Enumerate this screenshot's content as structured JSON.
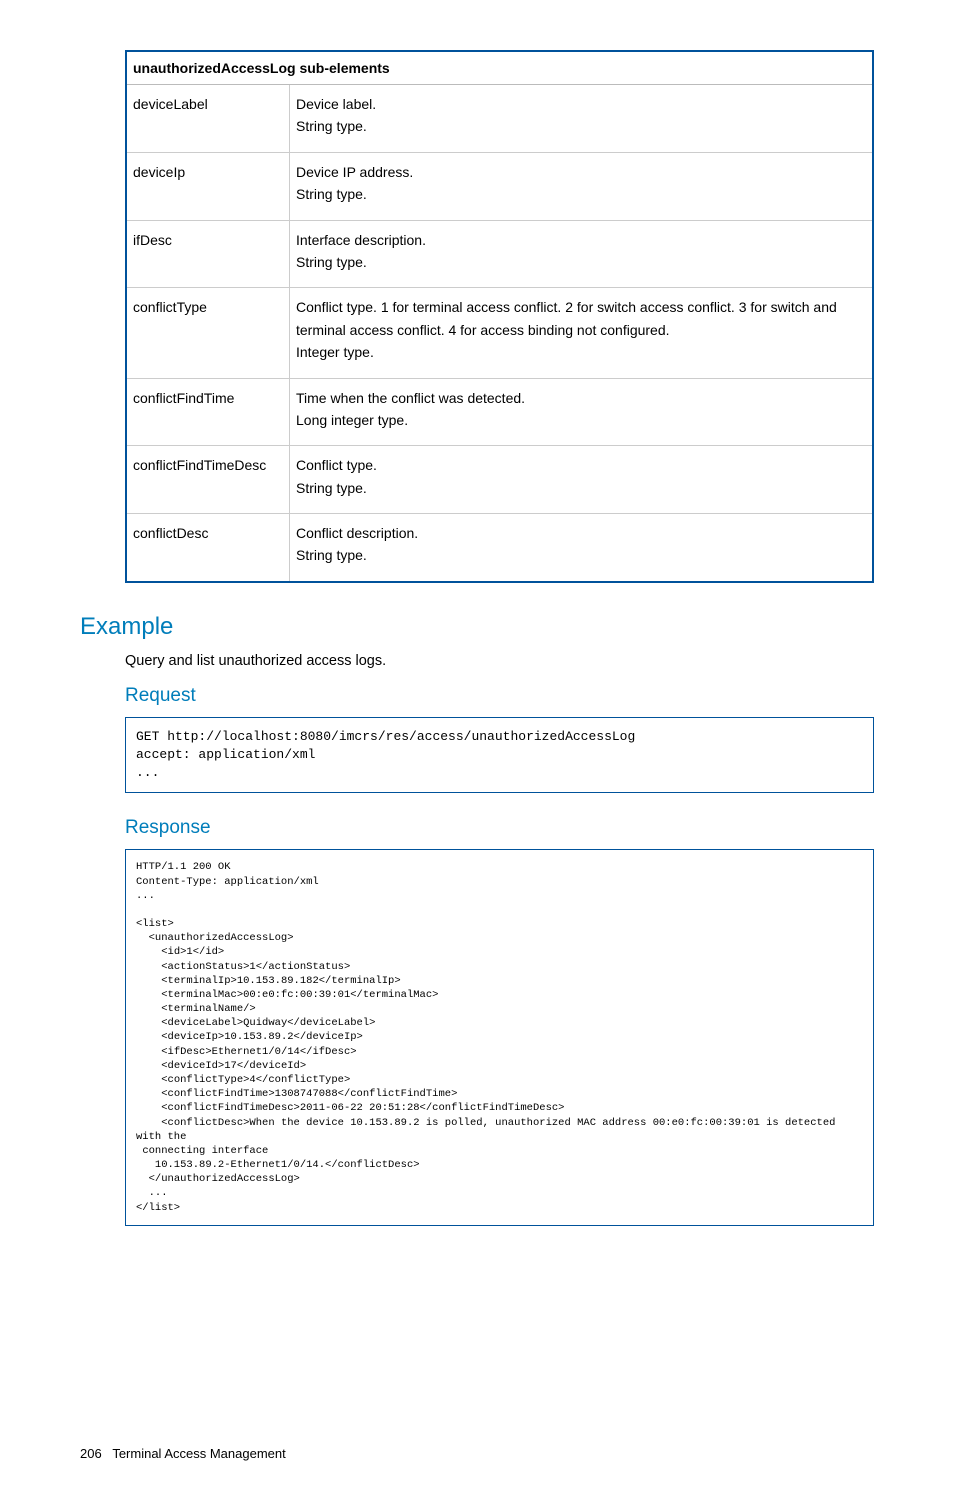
{
  "table": {
    "header": "unauthorizedAccessLog sub-elements",
    "rows": [
      {
        "name": "deviceLabel",
        "desc": "Device label.\nString type."
      },
      {
        "name": "deviceIp",
        "desc": "Device IP address.\nString type."
      },
      {
        "name": "ifDesc",
        "desc": "Interface description.\nString type."
      },
      {
        "name": "conflictType",
        "desc": "Conflict type. 1 for terminal access conflict. 2 for switch access conflict. 3 for switch and terminal access conflict. 4 for access binding not configured.\nInteger type."
      },
      {
        "name": "conflictFindTime",
        "desc": "Time when the conflict was detected.\nLong integer type."
      },
      {
        "name": "conflictFindTimeDesc",
        "desc": "Conflict type.\nString type."
      },
      {
        "name": "conflictDesc",
        "desc": "Conflict description.\nString type."
      }
    ]
  },
  "example": {
    "heading": "Example",
    "intro": "Query and list unauthorized access logs.",
    "request": {
      "heading": "Request",
      "code": "GET http://localhost:8080/imcrs/res/access/unauthorizedAccessLog\naccept: application/xml\n..."
    },
    "response": {
      "heading": "Response",
      "code": "HTTP/1.1 200 OK\nContent-Type: application/xml\n...\n\n<list>\n  <unauthorizedAccessLog>\n    <id>1</id>\n    <actionStatus>1</actionStatus>\n    <terminalIp>10.153.89.182</terminalIp>\n    <terminalMac>00:e0:fc:00:39:01</terminalMac>\n    <terminalName/>\n    <deviceLabel>Quidway</deviceLabel>\n    <deviceIp>10.153.89.2</deviceIp>\n    <ifDesc>Ethernet1/0/14</ifDesc>\n    <deviceId>17</deviceId>\n    <conflictType>4</conflictType>\n    <conflictFindTime>1308747088</conflictFindTime>\n    <conflictFindTimeDesc>2011-06-22 20:51:28</conflictFindTimeDesc>\n    <conflictDesc>When the device 10.153.89.2 is polled, unauthorized MAC address 00:e0:fc:00:39:01 is detected with the\n connecting interface\n   10.153.89.2-Ethernet1/0/14.</conflictDesc>\n  </unauthorizedAccessLog>\n  ...\n</list>"
    }
  },
  "footer": {
    "page_no": "206",
    "section": "Terminal Access Management"
  }
}
